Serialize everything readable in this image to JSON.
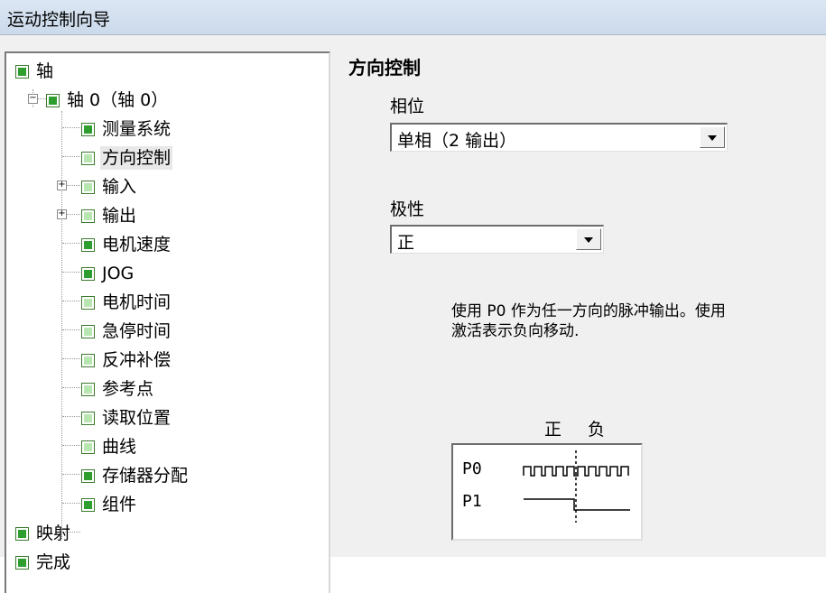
{
  "window": {
    "title": "运动控制向导"
  },
  "tree": {
    "items": [
      {
        "label": "轴",
        "checked": true
      },
      {
        "label": "轴 0（轴 0）",
        "checked": true
      },
      {
        "label": "测量系统",
        "checked": true
      },
      {
        "label": "方向控制",
        "checked": false
      },
      {
        "label": "输入",
        "checked": false
      },
      {
        "label": "输出",
        "checked": false
      },
      {
        "label": "电机速度",
        "checked": true
      },
      {
        "label": "JOG",
        "checked": true
      },
      {
        "label": "电机时间",
        "checked": false
      },
      {
        "label": "急停时间",
        "checked": false
      },
      {
        "label": "反冲补偿",
        "checked": false
      },
      {
        "label": "参考点",
        "checked": false
      },
      {
        "label": "读取位置",
        "checked": false
      },
      {
        "label": "曲线",
        "checked": false
      },
      {
        "label": "存储器分配",
        "checked": true
      },
      {
        "label": "组件",
        "checked": true
      },
      {
        "label": "映射",
        "checked": true
      },
      {
        "label": "完成",
        "checked": true
      }
    ]
  },
  "panel": {
    "title": "方向控制",
    "phase": {
      "label": "相位",
      "value": "单相（2 输出）"
    },
    "polarity": {
      "label": "极性",
      "value": "正"
    },
    "description": "使用 P0 作为任一方向的脉冲输出。使用\n激活表示负向移动.",
    "diagram": {
      "positive_label": "正",
      "negative_label": "负",
      "p0_label": "P0",
      "p1_label": "P1"
    }
  }
}
